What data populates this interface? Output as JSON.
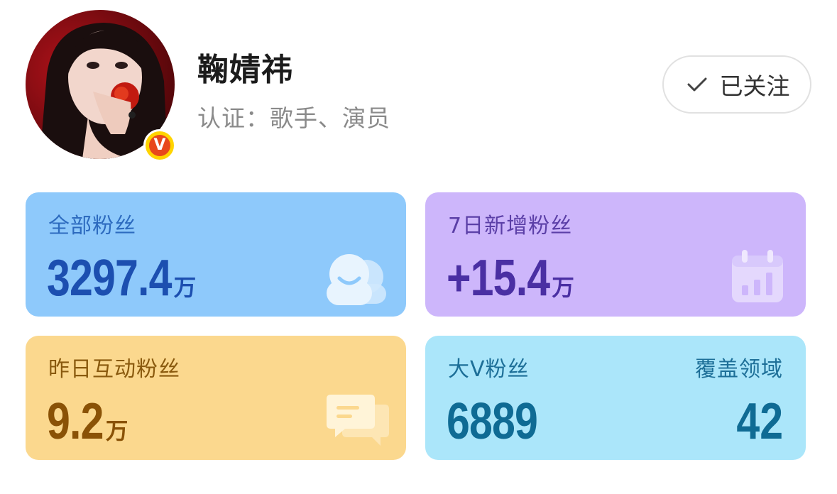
{
  "profile": {
    "name": "鞠婧祎",
    "verification": "认证：歌手、演员",
    "badge_letter": "V",
    "avatar_icon": "avatar-photo"
  },
  "follow_button": {
    "label": "已关注",
    "icon": "check-icon"
  },
  "stats": {
    "total": {
      "label": "全部粉丝",
      "value": "3297.4",
      "unit": "万",
      "icon": "users-icon",
      "color": "#8ec9fb"
    },
    "week": {
      "label": "7日新增粉丝",
      "value": "+15.4",
      "unit": "万",
      "icon": "bar-chart-calendar-icon",
      "color": "#cdb6fb"
    },
    "yesterday": {
      "label": "昨日互动粉丝",
      "value": "9.2",
      "unit": "万",
      "icon": "chat-icon",
      "color": "#fbd88e"
    },
    "bigv": {
      "label": "大V粉丝",
      "value": "6889",
      "right_label": "覆盖领域",
      "right_value": "42",
      "color": "#abe6fa"
    }
  }
}
